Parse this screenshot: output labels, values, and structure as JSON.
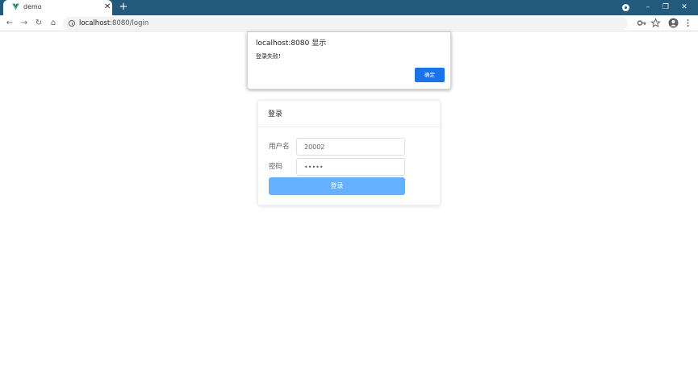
{
  "browser": {
    "tab_title": "demo",
    "tab_close": "✕",
    "new_tab": "+",
    "url_host": "localhost",
    "url_rest": ":8080/login",
    "window_buttons": [
      "–",
      "❐",
      "✕"
    ],
    "nav": {
      "back": "←",
      "forward": "→",
      "reload": "↻",
      "home": "⌂"
    },
    "icons": {
      "key": "key-icon",
      "star": "star-icon",
      "profile": "profile-icon",
      "menu": "menu-icon"
    }
  },
  "alert": {
    "title": "localhost:8080 显示",
    "message": "登录失败!",
    "ok_label": "确定"
  },
  "login": {
    "header": "登录",
    "username_label": "用户名",
    "username_value": "20002",
    "password_label": "密码",
    "password_value": "•••••",
    "submit_label": "登录"
  },
  "colors": {
    "titlebar": "#215a7d",
    "accent": "#1a73e8",
    "submit": "#66b1ff"
  }
}
